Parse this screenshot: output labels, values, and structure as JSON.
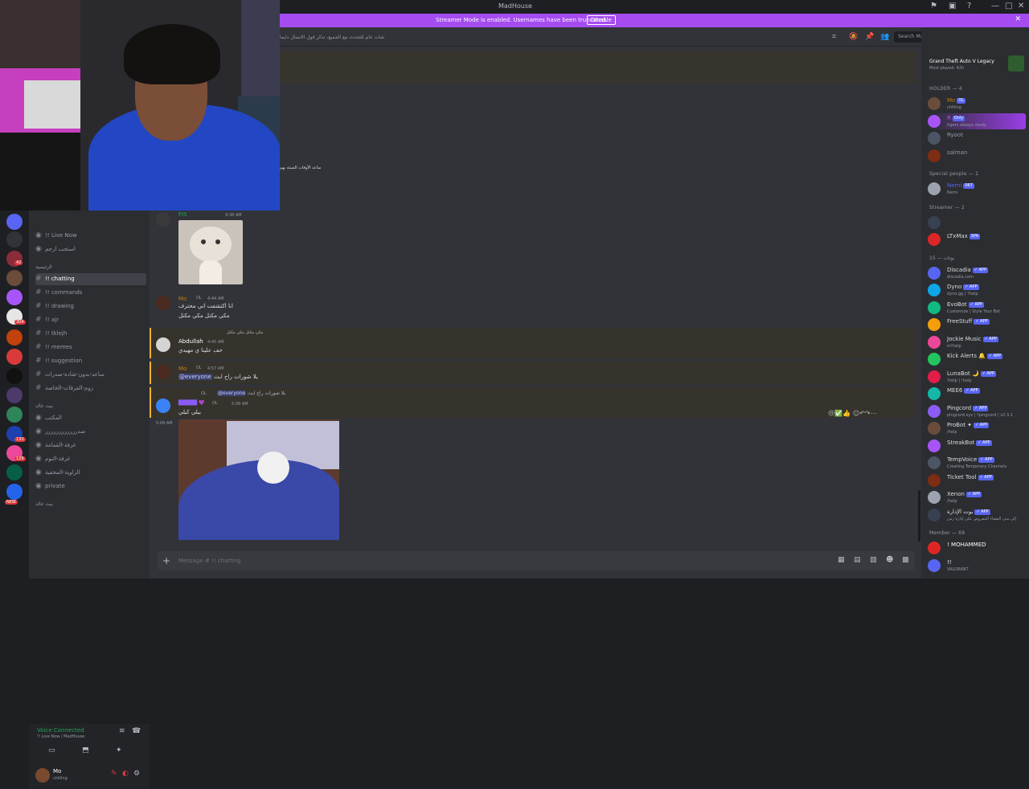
{
  "window": {
    "title": "MadHouse",
    "controls": [
      "—",
      "□",
      "✕"
    ]
  },
  "banner": {
    "text": "Streamer Mode is enabled. Usernames have been truncated.",
    "button": "Disable",
    "close": "✕"
  },
  "header": {
    "topic": "شات عام للتحدث مع الجميع، تذكر قول الاتصال دايماً",
    "search_placeholder": "Search MadHouse"
  },
  "servers": {
    "badges": [
      "42",
      "304",
      "133",
      "129",
      "NEW"
    ]
  },
  "channels": {
    "live_now_label": "!! Live Now",
    "voice_item": "استجب ارجم",
    "category1": "الرئيسية",
    "items": [
      {
        "name": "!! chatting",
        "active": true
      },
      {
        "name": "!! commands",
        "active": false
      },
      {
        "name": "!! drawing",
        "active": false
      },
      {
        "name": "!! ajr",
        "active": false
      },
      {
        "name": "!! tklejh",
        "active": false
      },
      {
        "name": "!! memes",
        "active": false
      },
      {
        "name": "!! suggestion",
        "active": false
      },
      {
        "name": "ساعد-بدون-شادة-صدرات",
        "active": false
      },
      {
        "name": "زوم-الفرقات-الخاصة",
        "active": false
      }
    ],
    "category2": "بيت خالد",
    "voice_channels": [
      "المكتب",
      "صدرررررررررررر",
      "غرفة-القمامة",
      "غرفة-النوم",
      "الزاوية-المخفية",
      "private"
    ],
    "category3": "بيت خالد"
  },
  "voice": {
    "status": "Voice Connected",
    "sub": "!! Live Now / MadHouse"
  },
  "user": {
    "name": "Mo",
    "status": "chilling"
  },
  "chat": {
    "pinned_note": "ساعد الأوقات السيئة بهم",
    "msg1": {
      "name": "FIS",
      "time": "4:38 AM"
    },
    "msg2": {
      "name": "Mo",
      "badge": "OL",
      "time": "4:44 AM",
      "line1": "انا اكتشفت اني محترف",
      "line2": "مكي مكتل مكي مكتل"
    },
    "msg3": {
      "reply": "مكي مكتل مكي مكتل",
      "name": "Abdullah",
      "time": "4:45 AM",
      "text": "حف علينا ي مهيدي"
    },
    "msg4": {
      "name": "Mo",
      "badge": "OL",
      "time": "4:57 AM",
      "mention": "@everyone",
      "text": "يلا شورات راح ابث"
    },
    "msg5": {
      "reply_mention": "@everyone",
      "reply_text": "يلا شورات راح ابث",
      "badge": "OL",
      "time": "5:09 AM",
      "text": "بيلي كيلي",
      "side_time": "5:09 AM"
    },
    "composer_placeholder": "Message # !! chatting"
  },
  "members": {
    "activity_title": "Grand Theft Auto V Legacy",
    "activity_sub": "Most played: 42h",
    "groups": [
      {
        "title": "HOLDER — 4",
        "items": [
          {
            "name": "Mo",
            "tag": "OL",
            "status": "chilling",
            "color": "#c27c0e"
          },
          {
            "name": "R",
            "tag": "Only",
            "status": "tigers always ready",
            "color": "#a855f7",
            "highlight": true
          },
          {
            "name": "Ryoot",
            "tag": "",
            "status": "",
            "color": "#949ba4"
          },
          {
            "name": "salman",
            "tag": "",
            "status": "",
            "color": "#949ba4"
          }
        ]
      },
      {
        "title": "Special people — 1",
        "items": [
          {
            "name": "Nemi",
            "tag": "067",
            "status": "Nemi",
            "color": "#5865f2"
          }
        ]
      },
      {
        "title": "Streamer — 2",
        "items": [
          {
            "name": "",
            "tag": "",
            "status": "",
            "color": "#dbdee1"
          },
          {
            "name": "LTxMax",
            "tag": "SPA",
            "status": "",
            "color": "#dbdee1"
          }
        ]
      },
      {
        "title": "15 — بوتات",
        "items": [
          {
            "name": "Discadia",
            "tag": "APP",
            "status": "discadia.com",
            "color": "#dbdee1"
          },
          {
            "name": "Dyno",
            "tag": "APP",
            "status": "dyno.gg | ?help",
            "color": "#dbdee1"
          },
          {
            "name": "EvoBot",
            "tag": "APP",
            "status": "Customize | Style Your Bot",
            "color": "#dbdee1"
          },
          {
            "name": "FreeStuff",
            "tag": "APP",
            "status": "",
            "color": "#dbdee1"
          },
          {
            "name": "Jockie Music",
            "tag": "APP",
            "status": "m!help",
            "color": "#dbdee1"
          },
          {
            "name": "Kick Alerts 🔔",
            "tag": "APP",
            "status": "",
            "color": "#dbdee1"
          },
          {
            "name": "LunaBot 🌙",
            "tag": "APP",
            "status": "!help | !help",
            "color": "#dbdee1"
          },
          {
            "name": "MEE6",
            "tag": "APP",
            "status": "",
            "color": "#dbdee1"
          },
          {
            "name": "Pingcord",
            "tag": "APP",
            "status": "pingcord.xyz | ?pingcord | v2.3.1",
            "color": "#dbdee1"
          },
          {
            "name": "ProBot ✦",
            "tag": "APP",
            "status": "/help",
            "color": "#dbdee1"
          },
          {
            "name": "StreakBot",
            "tag": "APP",
            "status": "",
            "color": "#dbdee1"
          },
          {
            "name": "TempVoice",
            "tag": "APP",
            "status": "Creating Temporary Channels",
            "color": "#dbdee1"
          },
          {
            "name": "Ticket Tool",
            "tag": "APP",
            "status": "",
            "color": "#dbdee1"
          },
          {
            "name": "Xenon",
            "tag": "APP",
            "status": "/help",
            "color": "#dbdee1"
          },
          {
            "name": "بوت الإدارة",
            "tag": "APP",
            "status": "إلى متى القضاء المفروض على إدارة زمن",
            "color": "#dbdee1"
          }
        ]
      },
      {
        "title": "Member — 69",
        "items": [
          {
            "name": "! MOHAMMED",
            "tag": "",
            "status": "",
            "color": "#ffffff"
          },
          {
            "name": "!!",
            "tag": "",
            "status": "VALORANT",
            "color": "#ffffff"
          }
        ]
      }
    ]
  },
  "colors": {
    "accent": "#a54cf0",
    "brand": "#5865f2",
    "green": "#23a559",
    "red": "#da373c"
  }
}
